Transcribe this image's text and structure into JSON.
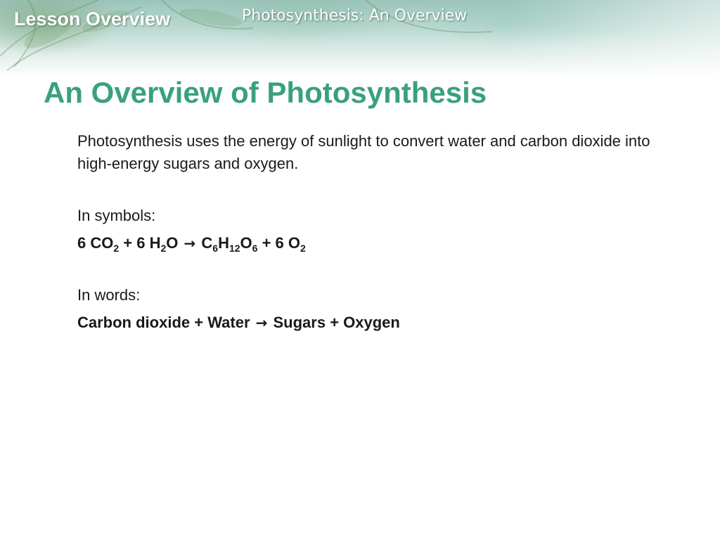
{
  "header": {
    "lesson_label": "Lesson Overview",
    "section_title": "Photosynthesis: An Overview"
  },
  "page_title": "An Overview of Photosynthesis",
  "content": {
    "intro": "Photosynthesis uses the energy of sunlight to convert water and carbon dioxide into high-energy sugars and oxygen.",
    "symbols_label": "In symbols:",
    "equation": {
      "reactant1_coef": "6 CO",
      "reactant1_sub": "2",
      "plus1": " + 6 H",
      "reactant2_sub": "2",
      "reactant2_tail": "O ",
      "arrow": "→",
      "product1_a": " C",
      "product1_sub1": "6",
      "product1_b": "H",
      "product1_sub2": "12",
      "product1_c": "O",
      "product1_sub3": "6",
      "plus2": " + 6 O",
      "product2_sub": "2"
    },
    "words_label": "In words:",
    "words_equation": {
      "left": "Carbon dioxide + Water ",
      "arrow": "→",
      "right": " Sugars + Oxygen"
    }
  },
  "colors": {
    "title": "#3aa17a",
    "header_text": "#ffffff"
  }
}
